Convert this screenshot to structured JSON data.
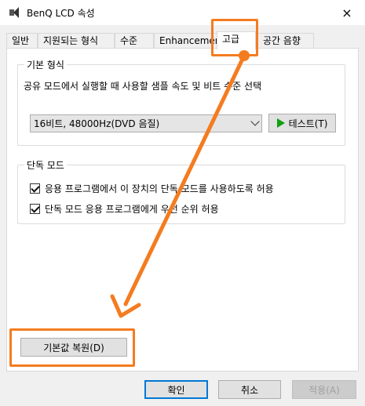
{
  "window": {
    "title": "BenQ LCD 속성",
    "close_icon": "×"
  },
  "tabs": [
    {
      "label": "일반"
    },
    {
      "label": "지원되는 형식"
    },
    {
      "label": "수준"
    },
    {
      "label": "Enhancements"
    },
    {
      "label": "고급"
    },
    {
      "label": "공간 음향"
    }
  ],
  "default_format": {
    "group_label": "기본 형식",
    "description": "공유 모드에서 실행할 때 사용할 샘플 속도 및 비트 수준 선택",
    "selected_value": "16비트, 48000Hz(DVD 음질)",
    "test_button": "테스트(T)"
  },
  "exclusive_mode": {
    "group_label": "단독 모드",
    "options": [
      {
        "label": "응용 프로그램에서 이 장치의 단독 모드를 사용하도록 허용",
        "checked": true
      },
      {
        "label": "단독 모드 응용 프로그램에게 우선 순위 허용",
        "checked": true
      }
    ]
  },
  "restore_defaults": {
    "label": "기본값 복원(D)"
  },
  "footer": {
    "ok": "확인",
    "cancel": "취소",
    "apply": "적용(A)"
  },
  "colors": {
    "annotation": "#f47c20",
    "primary_border": "#0078d7",
    "play_icon": "#10a010"
  }
}
